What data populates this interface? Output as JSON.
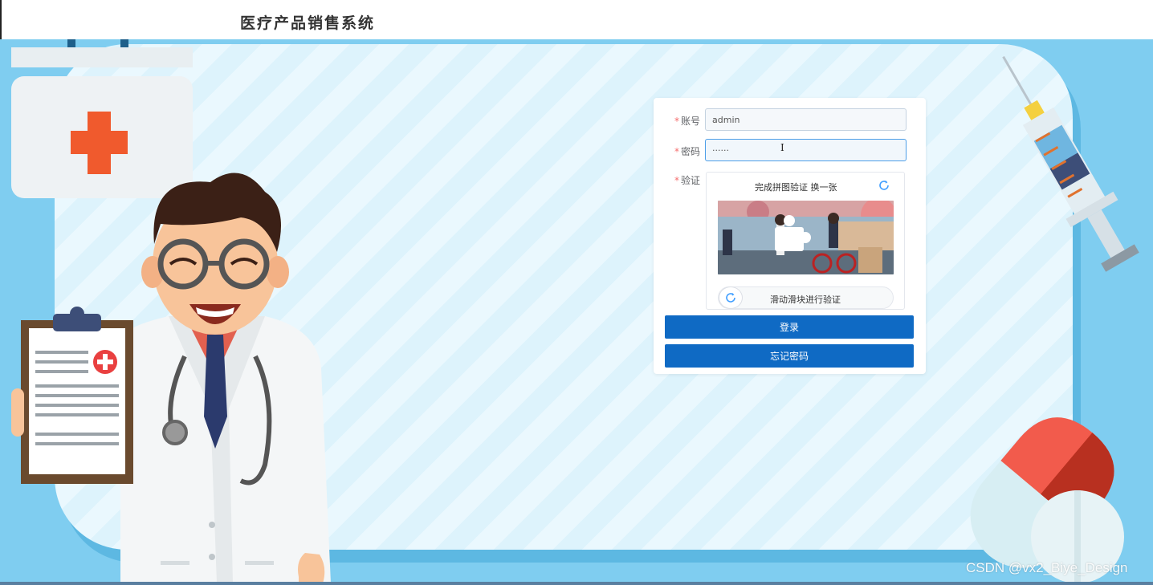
{
  "header": {
    "title": "医疗产品销售系统"
  },
  "login_form": {
    "account": {
      "label": "账号",
      "value": "admin"
    },
    "password": {
      "label": "密码",
      "value": "······"
    },
    "verify": {
      "label": "验证",
      "tip": "完成拼图验证  换一张",
      "slider_text": "滑动滑块进行验证"
    },
    "login_button": "登录",
    "forgot_button": "忘记密码"
  },
  "watermark": "CSDN @vx2_Biye_Design",
  "colors": {
    "primary": "#0f6ac4",
    "background": "#7fcdf0",
    "required": "#f56c6c"
  },
  "icons": {
    "captcha_refresh": "refresh-icon",
    "slider_handle": "refresh-icon",
    "text_cursor": "ibeam-cursor-icon"
  }
}
